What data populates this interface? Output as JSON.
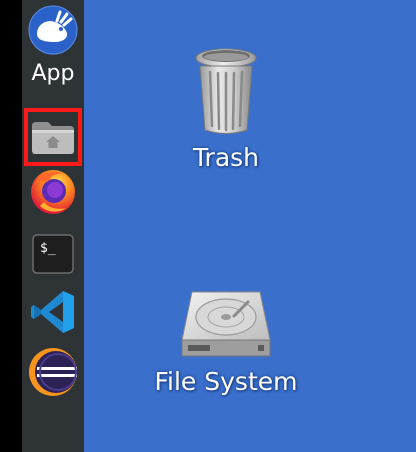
{
  "dock": {
    "items": [
      {
        "icon": "xfce-mouse-icon",
        "label": "App"
      },
      {
        "icon": "home-folder-icon",
        "label": ""
      },
      {
        "icon": "firefox-icon",
        "label": ""
      },
      {
        "icon": "terminal-icon",
        "label": "",
        "glyph": "$_"
      },
      {
        "icon": "vscode-icon",
        "label": ""
      },
      {
        "icon": "eclipse-icon",
        "label": ""
      }
    ],
    "highlighted_index": 1,
    "highlight_color": "#ff1a1a"
  },
  "desktop": {
    "background_color": "#3a6fcb",
    "icons": [
      {
        "icon": "trash-icon",
        "label": "Trash"
      },
      {
        "icon": "hard-drive-icon",
        "label": "File System"
      }
    ]
  }
}
